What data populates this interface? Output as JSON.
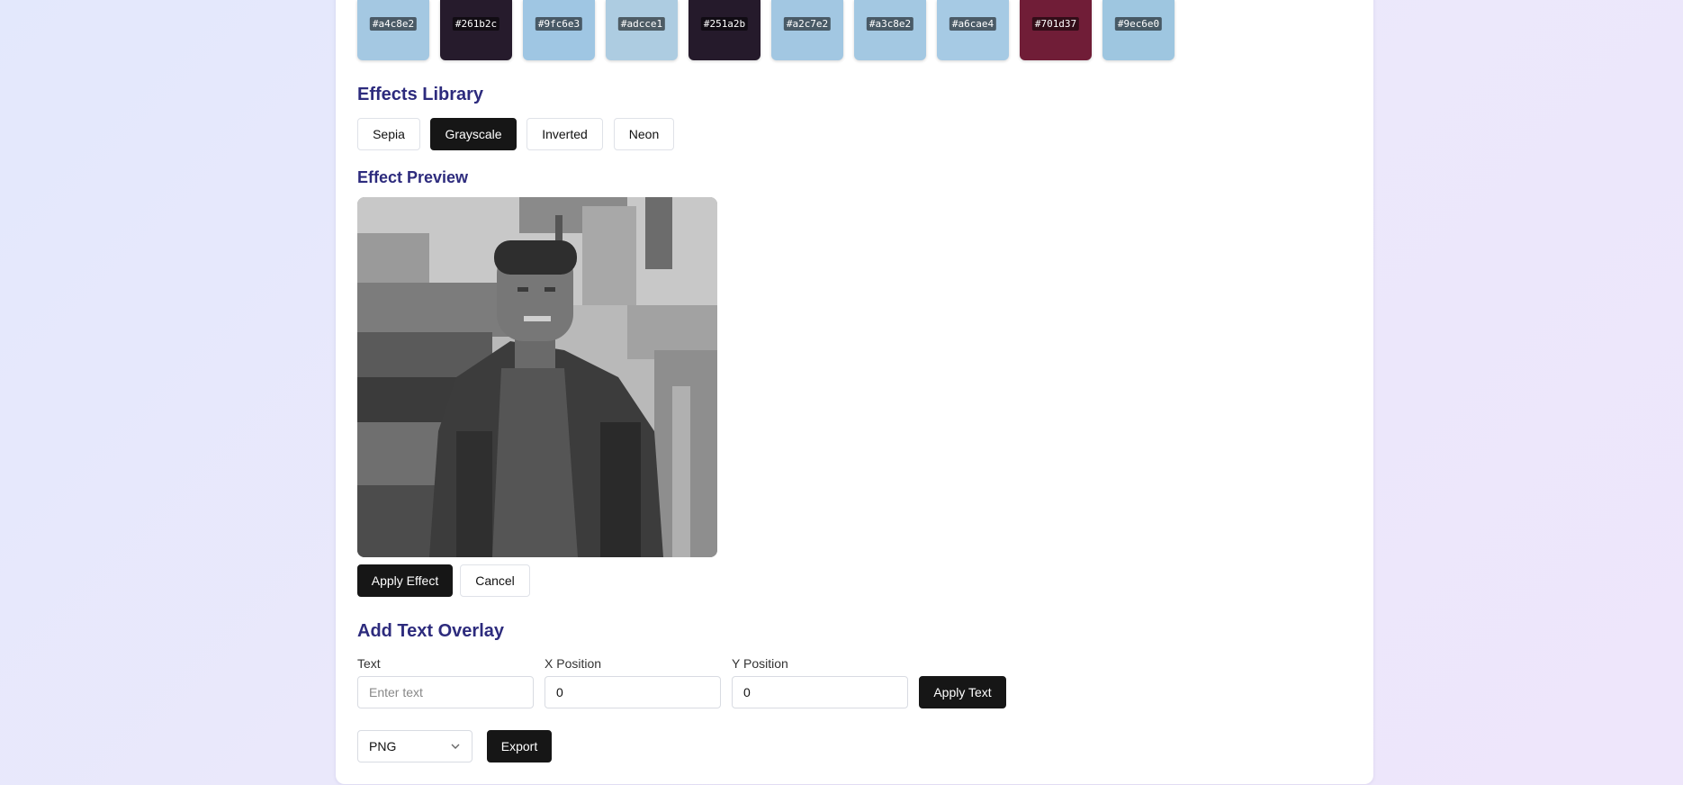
{
  "palette": [
    {
      "hex": "#a4c8e2",
      "label": "#a4c8e2"
    },
    {
      "hex": "#261b2c",
      "label": "#261b2c"
    },
    {
      "hex": "#9fc6e3",
      "label": "#9fc6e3"
    },
    {
      "hex": "#adcce1",
      "label": "#adcce1"
    },
    {
      "hex": "#251a2b",
      "label": "#251a2b"
    },
    {
      "hex": "#a2c7e2",
      "label": "#a2c7e2"
    },
    {
      "hex": "#a3c8e2",
      "label": "#a3c8e2"
    },
    {
      "hex": "#a6cae4",
      "label": "#a6cae4"
    },
    {
      "hex": "#701d37",
      "label": "#701d37"
    },
    {
      "hex": "#9ec6e0",
      "label": "#9ec6e0"
    }
  ],
  "effects": {
    "heading": "Effects Library",
    "buttons": [
      "Sepia",
      "Grayscale",
      "Inverted",
      "Neon"
    ],
    "active": "Grayscale"
  },
  "preview": {
    "heading": "Effect Preview",
    "apply_label": "Apply Effect",
    "cancel_label": "Cancel"
  },
  "overlay": {
    "heading": "Add Text Overlay",
    "text_label": "Text",
    "text_placeholder": "Enter text",
    "text_value": "",
    "x_label": "X Position",
    "x_value": "0",
    "y_label": "Y Position",
    "y_value": "0",
    "apply_label": "Apply Text"
  },
  "export": {
    "format": "PNG",
    "button_label": "Export"
  },
  "theme": {
    "heading_color": "#2d2b7d",
    "primary_button": "#161616"
  }
}
